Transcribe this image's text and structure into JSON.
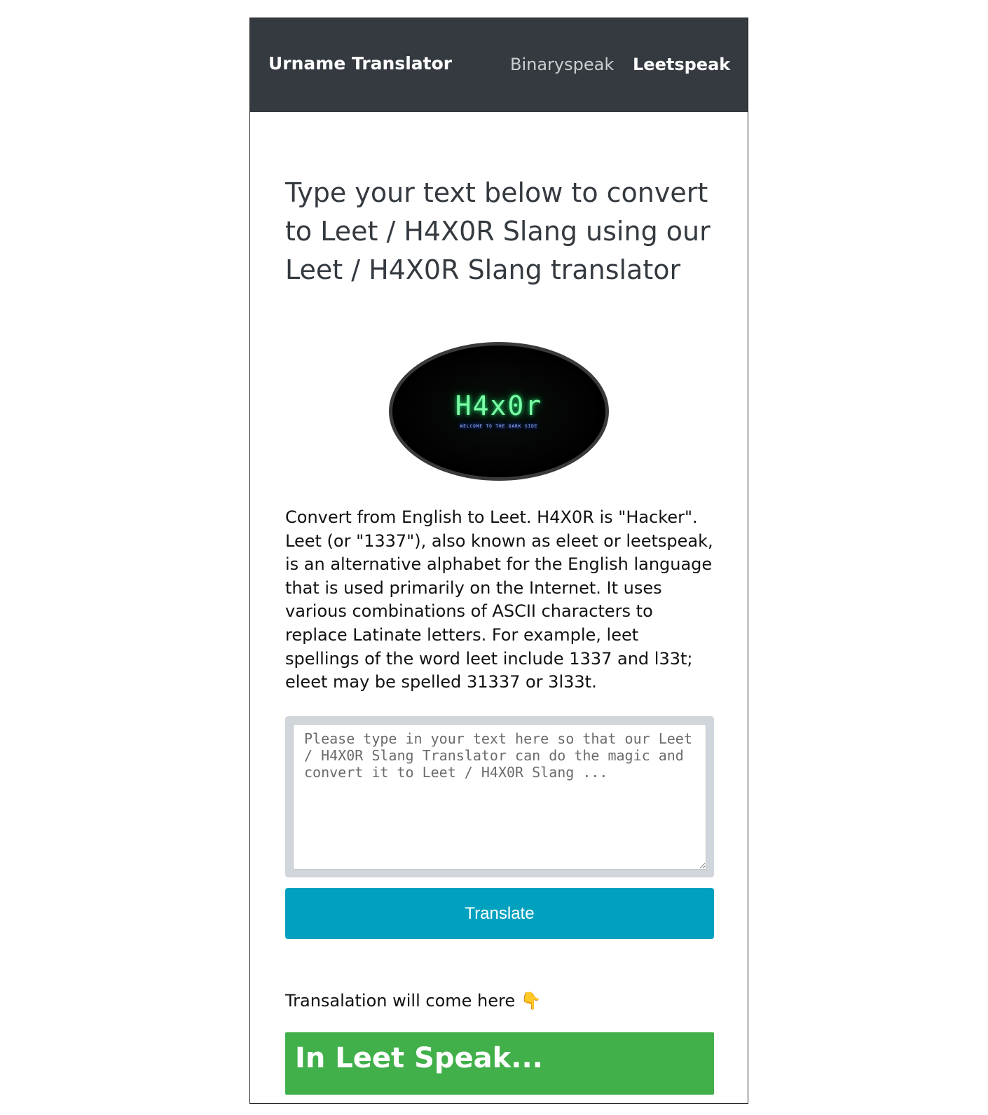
{
  "navbar": {
    "brand": "Urname Translator",
    "links": [
      {
        "label": "Binaryspeak",
        "active": false
      },
      {
        "label": "Leetspeak",
        "active": true
      }
    ]
  },
  "main": {
    "heading": "Type your text below to convert to Leet / H4X0R Slang using our Leet / H4X0R Slang translator",
    "logo": {
      "title": "H4x0r",
      "subtitle": "WELCOME TO THE DARK SIDE"
    },
    "description": "Convert from English to Leet. H4X0R is \"Hacker\". Leet (or \"1337\"), also known as eleet or leetspeak, is an alternative alphabet for the English language that is used primarily on the Internet. It uses various combinations of ASCII characters to replace Latinate letters. For example, leet spellings of the word leet include 1337 and l33t; eleet may be spelled 31337 or 3l33t.",
    "input": {
      "value": "",
      "placeholder": "Please type in your text here so that our Leet / H4X0R Slang Translator can do the magic and convert it to Leet / H4X0R Slang ..."
    },
    "translate_button": "Translate",
    "result_label": "Transalation will come here 👇",
    "result_text": "In Leet Speak..."
  },
  "colors": {
    "navbar_bg": "#343a40",
    "button_bg": "#00a1bf",
    "result_bg": "#41b04a"
  }
}
